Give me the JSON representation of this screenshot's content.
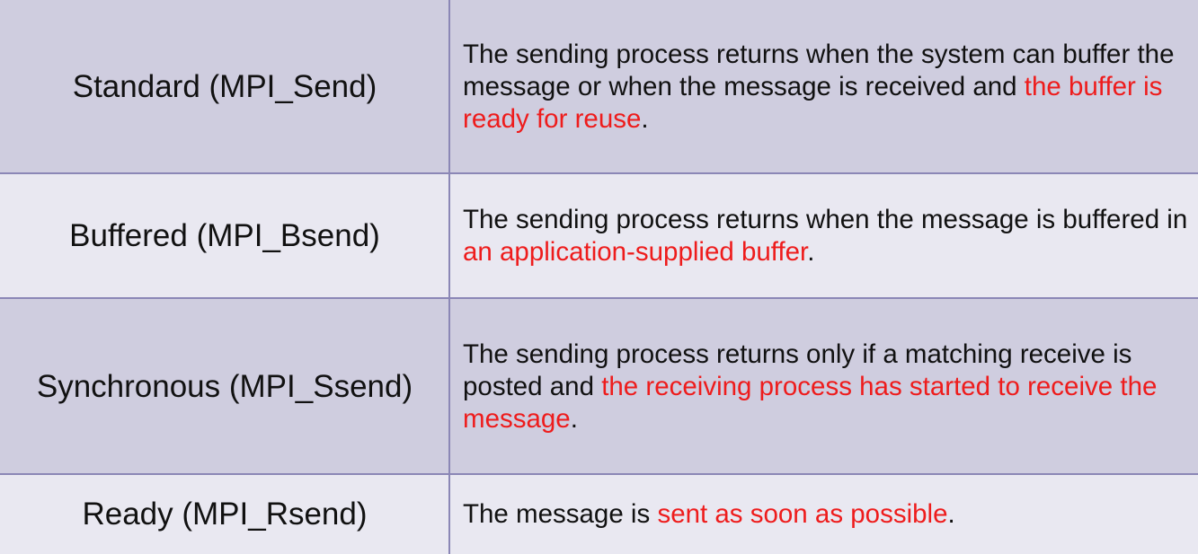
{
  "rows": [
    {
      "mode": "Standard (MPI_Send)",
      "desc_before": "The sending process returns when the system can buffer the message or when the message is received and ",
      "desc_highlight": "the buffer is ready for reuse",
      "desc_after": "."
    },
    {
      "mode": "Buffered (MPI_Bsend)",
      "desc_before": "The sending process returns when the message is buffered in ",
      "desc_highlight": "an application-supplied buffer",
      "desc_after": "."
    },
    {
      "mode": "Synchronous (MPI_Ssend)",
      "desc_before": "The sending process returns only if a matching receive is posted and ",
      "desc_highlight": "the receiving process has started to receive the message",
      "desc_after": "."
    },
    {
      "mode": "Ready (MPI_Rsend)",
      "desc_before": "The message is ",
      "desc_highlight": "sent as soon as possible",
      "desc_after": "."
    }
  ],
  "colors": {
    "row_dark": "#cfcddf",
    "row_light": "#e9e8f1",
    "grid_line": "#8b87b6",
    "highlight": "#ee1c1c",
    "text": "#111111"
  }
}
